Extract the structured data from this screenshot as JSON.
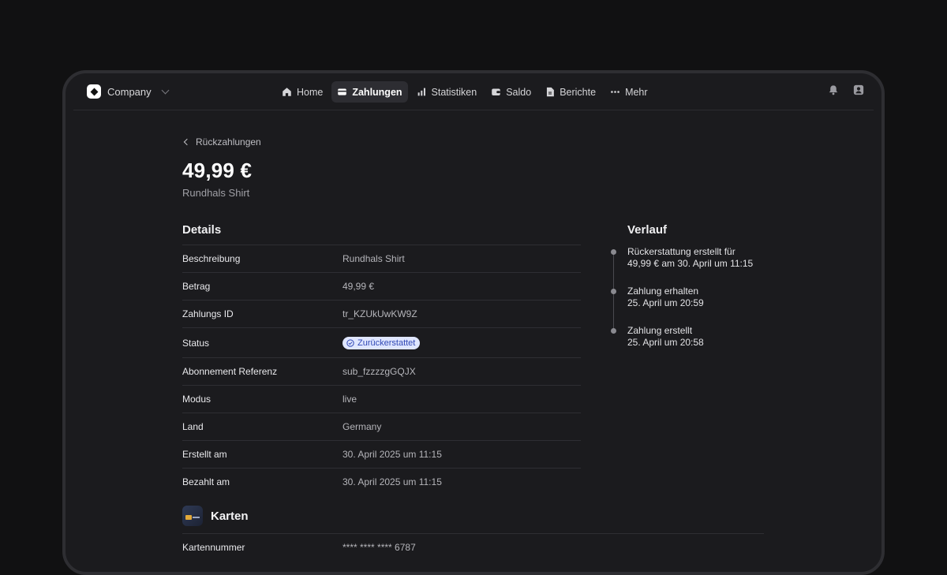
{
  "company": {
    "name": "Company"
  },
  "nav": {
    "items": [
      {
        "label": "Home",
        "icon": "home-icon",
        "active": false
      },
      {
        "label": "Zahlungen",
        "icon": "payments-icon",
        "active": true
      },
      {
        "label": "Statistiken",
        "icon": "chart-icon",
        "active": false
      },
      {
        "label": "Saldo",
        "icon": "wallet-icon",
        "active": false
      },
      {
        "label": "Berichte",
        "icon": "document-icon",
        "active": false
      },
      {
        "label": "Mehr",
        "icon": "more-icon",
        "active": false
      }
    ]
  },
  "topbar_icons": [
    "bell-icon",
    "user-icon"
  ],
  "page": {
    "back_label": "Rückzahlungen",
    "amount": "49,99 €",
    "product": "Rundhals Shirt"
  },
  "details": {
    "title": "Details",
    "rows": [
      {
        "label": "Beschreibung",
        "value": "Rundhals Shirt"
      },
      {
        "label": "Betrag",
        "value": "49,99 €"
      },
      {
        "label": "Zahlungs ID",
        "value": "tr_KZUkUwKW9Z"
      },
      {
        "label": "Status",
        "value": "Zurückerstattet",
        "badge": true
      },
      {
        "label": "Abonnement Referenz",
        "value": "sub_fzzzzgGQJX"
      },
      {
        "label": "Modus",
        "value": "live"
      },
      {
        "label": "Land",
        "value": "Germany"
      },
      {
        "label": "Erstellt am",
        "value": "30. April 2025 um 11:15"
      },
      {
        "label": "Bezahlt am",
        "value": "30. April 2025 um 11:15"
      }
    ]
  },
  "history": {
    "title": "Verlauf",
    "items": [
      {
        "line1": "Rückerstattung erstellt für",
        "line2": "49,99 € am 30. April um 11:15"
      },
      {
        "line1": "Zahlung erhalten",
        "line2": "25. April um 20:59"
      },
      {
        "line1": "Zahlung erstellt",
        "line2": "25. April um 20:58"
      }
    ]
  },
  "cards": {
    "title": "Karten",
    "rows": [
      {
        "label": "Kartennummer",
        "value": "**** **** **** 6787"
      }
    ]
  },
  "colors": {
    "background": "#111112",
    "panel": "#1b1b1e",
    "badge_bg": "#dfe6ff",
    "badge_text": "#3048b4"
  }
}
